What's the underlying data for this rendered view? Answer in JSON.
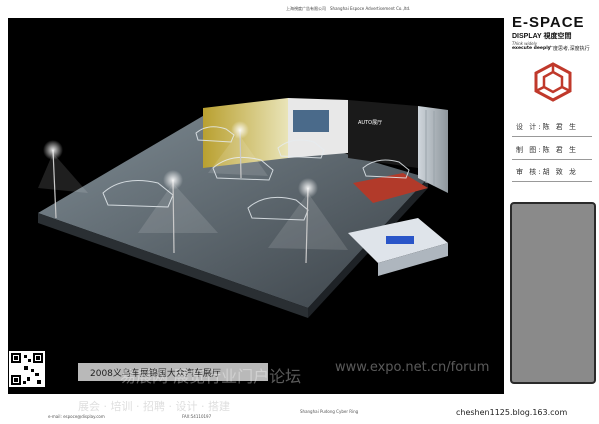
{
  "header": {
    "company_cn": "上海視度广告有限公司",
    "company_en": "Shanghai Espoce Advertisement Co.,ltd."
  },
  "brand": {
    "logo_line1": "E-SPACE",
    "logo_line2": "DISPLAY 視度空間",
    "slogan_en_1": "Think widely",
    "slogan_en_2": "execute deeply",
    "slogan_cn": "广度思考,深度执行"
  },
  "signoff": {
    "design": "设 计:陈 君 生",
    "drawing": "制 图:陈 君 生",
    "review": "审 核:胡 致 龙"
  },
  "render": {
    "exhibit_title": "2008义乌车展锦国大众汽车展厅",
    "banner_text": "AUTO展厅",
    "watermark_cn": "易展网 展览行业门户论坛",
    "watermark_url": "www.expo.net.cn/forum",
    "watermark_sub": "展会 · 培训 · 招聘 · 设计 · 搭建"
  },
  "footer": {
    "fax": "FAX:54110197",
    "address": "Shanghai Pudong Cyber Ring",
    "blog": "cheshen1125.blog.163.com",
    "email": "e-mail: espoce@display.com"
  },
  "colors": {
    "logo_red": "#c0392b",
    "panel_grey": "#8a8a8a"
  }
}
